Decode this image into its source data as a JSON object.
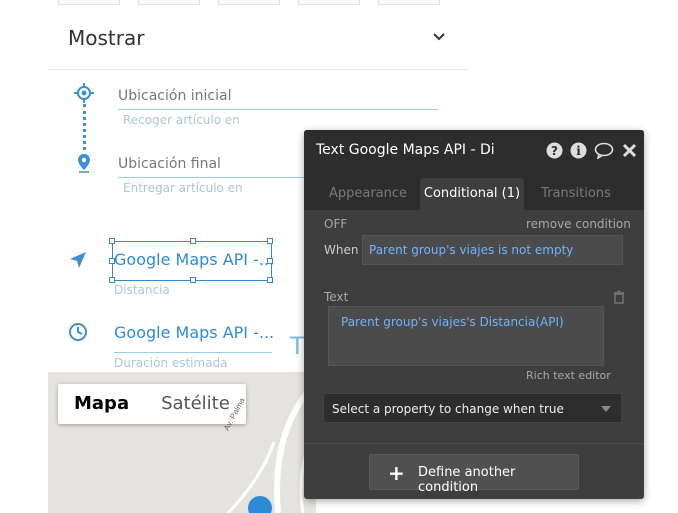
{
  "mostrar": {
    "label": "Mostrar"
  },
  "origin": {
    "label": "Ubicación inicial",
    "placeholder": "Recoger artículo en"
  },
  "destination": {
    "label": "Ubicación final",
    "placeholder": "Entregar artículo en"
  },
  "distance": {
    "value": "Google Maps API -...",
    "sub": "Distancia"
  },
  "duration": {
    "value": "Google Maps API -...",
    "sub": "Duración estimada"
  },
  "stray_text": "T",
  "map": {
    "buttons": [
      "Mapa",
      "Satélite"
    ],
    "active": "Mapa",
    "road_label": "Av. Palma"
  },
  "panel": {
    "title": "Text Google Maps API - Di",
    "tabs": [
      "Appearance",
      "Conditional (1)",
      "Transitions"
    ],
    "active_tab": "Conditional (1)",
    "off_label": "OFF",
    "remove_label": "remove condition",
    "when_label": "When",
    "when_value": "Parent group's viajes is not empty",
    "text_label": "Text",
    "text_value": "Parent group's viajes's Distancia(API)",
    "rich_text_label": "Rich text editor",
    "property_placeholder": "Select a property to change when true",
    "define_label": "Define another condition"
  },
  "colors": {
    "accent": "#2e8bd8",
    "panel_bg": "#3e3e3e",
    "panel_dark": "#2d2d2d",
    "expression": "#6fb3ff"
  }
}
